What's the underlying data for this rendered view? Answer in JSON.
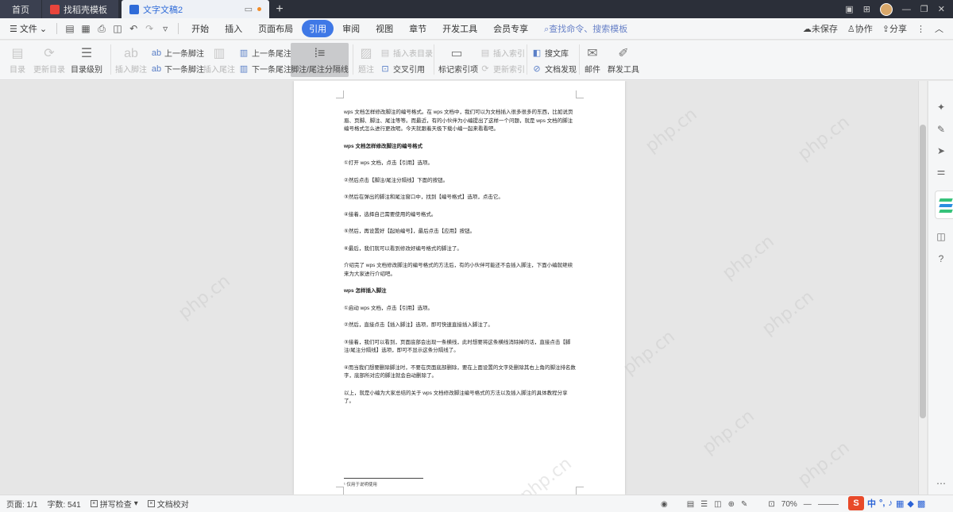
{
  "tabs": {
    "home": "首页",
    "template": "找稻壳模板",
    "document": "文字文稿2"
  },
  "menubar": {
    "file": "文件",
    "items": [
      "开始",
      "插入",
      "页面布局",
      "引用",
      "审阅",
      "视图",
      "章节",
      "开发工具",
      "会员专享"
    ],
    "active_item": "引用",
    "search": "查找命令、搜索模板",
    "unsaved": "未保存",
    "collaborate": "协作",
    "share": "分享"
  },
  "ribbon": {
    "toc": "目录",
    "update_toc": "更新目录",
    "toc_level": "目录级别",
    "insert_footnote": "插入脚注",
    "prev_footnote": "上一条脚注",
    "next_footnote": "下一条脚注",
    "insert_endnote": "插入尾注",
    "prev_endnote": "上一条尾注",
    "next_endnote": "下一条尾注",
    "separator": "脚注/尾注分隔线",
    "caption": "题注",
    "insert_table_toc": "插入表目录",
    "cross_ref": "交叉引用",
    "mark_index": "标记索引项",
    "insert_index": "插入索引",
    "update_index": "更新索引",
    "search_lib": "搜文库",
    "doc_discover": "文档发现",
    "mail": "邮件",
    "mass_tool": "群发工具"
  },
  "document": {
    "paragraphs": [
      {
        "text": "wps 文档怎样修改脚注的编号格式。在 wps 文档中，我们可以为文档插入很多很多的东西，比如说页眉、页脚、脚注、尾注等等。而最近，有的小伙伴为小编提出了这样一个问题，就是 wps 文档的脚注编号格式怎么进行更改呢。今天就跟着天极下载小编一起来看看吧。",
        "bold": false
      },
      {
        "text": "wps 文档怎样修改脚注的编号格式",
        "bold": true
      },
      {
        "text": "①打开 wps 文档，点击【引用】选项。",
        "bold": false
      },
      {
        "text": "②然后点击【脚注/尾注分隔线】下面的按钮。",
        "bold": false
      },
      {
        "text": "③然后在弹出的脚注和尾注窗口中，找到【编号格式】选项，点击它。",
        "bold": false
      },
      {
        "text": "④接着，选择自己需要使用的编号格式。",
        "bold": false
      },
      {
        "text": "⑤然后，再设置好【起始编号】，最后点击【应用】按钮。",
        "bold": false
      },
      {
        "text": "⑥最后，我们就可以看到修改好编号格式的脚注了。",
        "bold": false
      },
      {
        "text": "介绍完了 wps 文档修改脚注的编号格式的方法后，有的小伙伴可能还不会插入脚注，下面小编就继续来为大家进行介绍吧。",
        "bold": false
      },
      {
        "text": "wps 怎样插入脚注",
        "bold": true
      },
      {
        "text": "①启动 wps 文档，点击【引用】选项。",
        "bold": false
      },
      {
        "text": "②然后，直接点击【插入脚注】选项，即可快速直接插入脚注了。",
        "bold": false
      },
      {
        "text": "③接着，我们可以看到，页面底部会出现一条横线，此时想要将这条横线消除掉的话，直接点击【脚注/尾注分隔线】选项，即可不显示这条分隔线了。",
        "bold": false
      },
      {
        "text": "④而当我们想要删除脚注时，不要在页面底部删除，要在上面设置的文字处删除其右上角的脚注排名数字，底部所对应的脚注就会自动删除了。",
        "bold": false
      },
      {
        "text": "以上，就是小编为大家总结的关于 wps 文档修改脚注编号格式的方法以及插入脚注的具体教程分享了。",
        "bold": false
      }
    ],
    "footnote": "¹ 仅用于说明使用",
    "watermark": "php.cn"
  },
  "statusbar": {
    "page": "页面: 1/1",
    "words": "字数: 541",
    "spell": "拼写检查",
    "proof": "文档校对",
    "zoom": "70%"
  },
  "ime": {
    "logo": "S",
    "lang": "中"
  }
}
